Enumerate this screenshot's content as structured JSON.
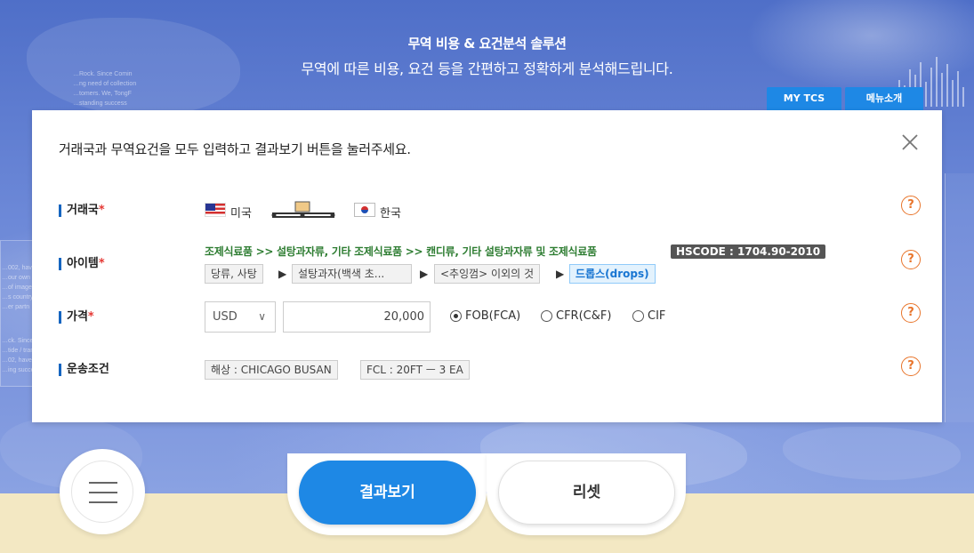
{
  "hero": {
    "title": "무역 비용 & 요건분석 솔루션",
    "subtitle": "무역에 따른 비용, 요건 등을 간편하고 정확하게 분석해드립니다.",
    "bg_text_1": "…Rock. Since Comin\n…ng need of collection\n…tomers. We, TongF\n…standing success",
    "bg_text_2": "…002, have\n…our own\n…of image St\n…s country\n…er partn",
    "bg_text_3": "…ck. Since Co\n…tide / trans\n…02, have\n…ing succes"
  },
  "top_buttons": {
    "mytcs": "MY TCS",
    "menu_intro": "메뉴소개"
  },
  "modal": {
    "instruction": "거래국과 무역요건을 모두 입력하고 결과보기 버튼을 눌러주세요.",
    "close_symbol": "✕",
    "help_symbol": "?",
    "required_mark": "*",
    "rows": {
      "country": {
        "label": "거래국",
        "from": "미국",
        "to": "한국"
      },
      "item": {
        "label": "아이템",
        "path": "조제식료품 >> 설탕과자류, 기타 조제식료품 >> 캔디류, 기타 설탕과자류 및 조제식료품",
        "hscode": "HSCODE : 1704.90-2010",
        "chips": [
          "당류, 사탕",
          "설탕과자(백색 초...",
          "<추잉껌> 이외의 것",
          "드롭스(drops)"
        ],
        "arrow": "▶"
      },
      "price": {
        "label": "가격",
        "currency": "USD",
        "amount": "20,000",
        "options": [
          "FOB(FCA)",
          "CFR(C&F)",
          "CIF"
        ],
        "selected": "FOB(FCA)"
      },
      "shipping": {
        "label": "운송조건",
        "route": "해상 : CHICAGO BUSAN",
        "container": "FCL : 20FT ㅡ 3 EA"
      }
    }
  },
  "bottom": {
    "result_label": "결과보기",
    "reset_label": "리셋"
  },
  "colors": {
    "accent": "#1e88e5",
    "required": "#e53935",
    "help": "#e8742a",
    "path": "#2e7d32",
    "band": "#f3e8c3"
  }
}
